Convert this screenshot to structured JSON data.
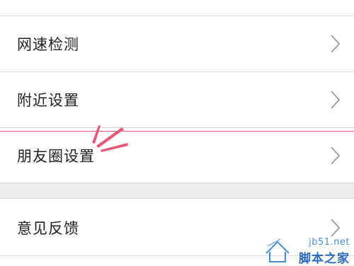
{
  "settings": {
    "items": [
      {
        "label": "网速检测"
      },
      {
        "label": "附近设置"
      },
      {
        "label": "朋友圈设置"
      },
      {
        "label": "意见反馈"
      }
    ]
  },
  "annotation": {
    "pointer": "highlight-marker-icon",
    "highlight_color": "#e8577a"
  },
  "watermark": {
    "domain": "jb51.net",
    "name": "脚本之家"
  }
}
